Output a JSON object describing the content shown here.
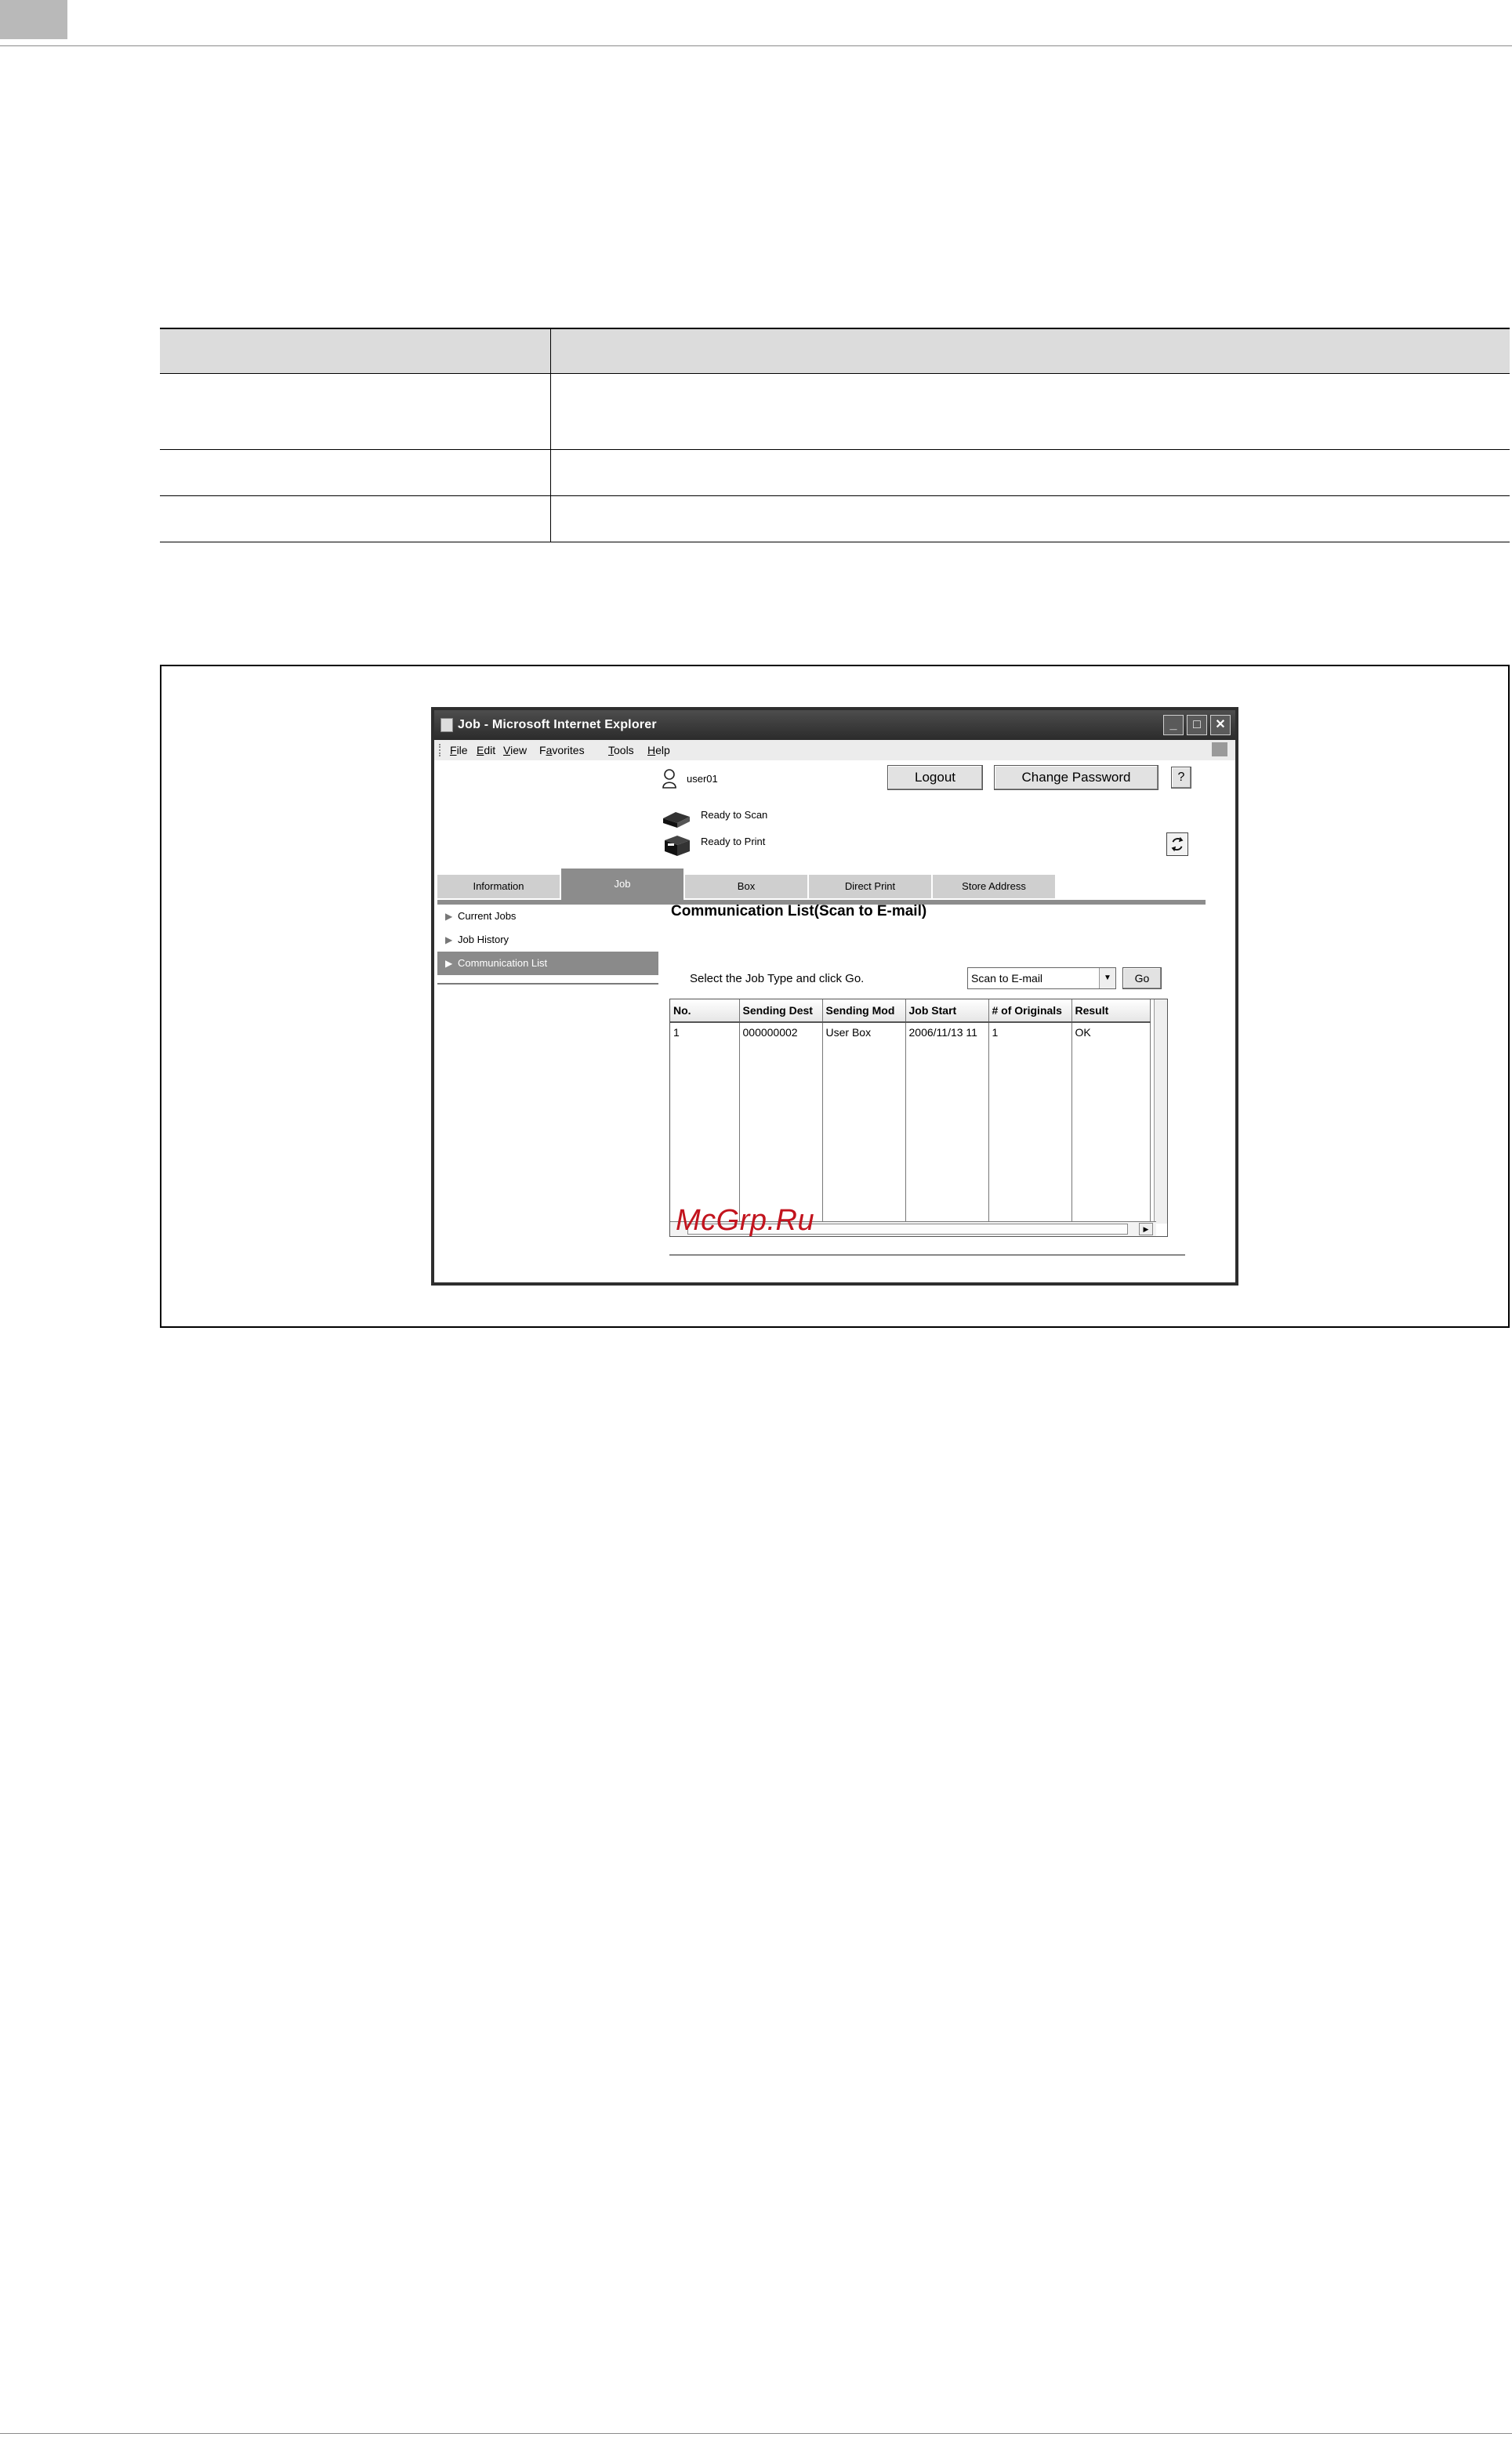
{
  "window": {
    "title": "Job - Microsoft Internet Explorer",
    "menu": [
      "File",
      "Edit",
      "View",
      "Favorites",
      "Tools",
      "Help"
    ],
    "menu_underline": [
      "F",
      "E",
      "V",
      "a",
      "T",
      "H"
    ]
  },
  "header": {
    "user_name": "user01",
    "logout_label": "Logout",
    "change_password_label": "Change Password",
    "help_label": "?",
    "status_scan": "Ready to Scan",
    "status_print": "Ready to Print"
  },
  "tabs": [
    {
      "label": "Information",
      "active": false
    },
    {
      "label": "Job",
      "active": true
    },
    {
      "label": "Box",
      "active": false
    },
    {
      "label": "Direct Print",
      "active": false
    },
    {
      "label": "Store Address",
      "active": false
    }
  ],
  "sidebar": {
    "items": [
      {
        "label": "Current Jobs",
        "active": false
      },
      {
        "label": "Job History",
        "active": false
      },
      {
        "label": "Communication List",
        "active": true
      }
    ]
  },
  "main": {
    "title": "Communication List(Scan to E-mail)",
    "job_type_label": "Select the Job Type and click Go.",
    "job_type_value": "Scan to E-mail",
    "go_label": "Go",
    "table": {
      "columns": [
        "No.",
        "Sending Dest",
        "Sending Mod",
        "Job Start",
        "# of Originals",
        "Result"
      ],
      "rows": [
        [
          "1",
          "000000002",
          "User Box",
          "2006/11/13 11",
          "1",
          "OK"
        ]
      ]
    }
  },
  "watermark": "McGrp.Ru"
}
